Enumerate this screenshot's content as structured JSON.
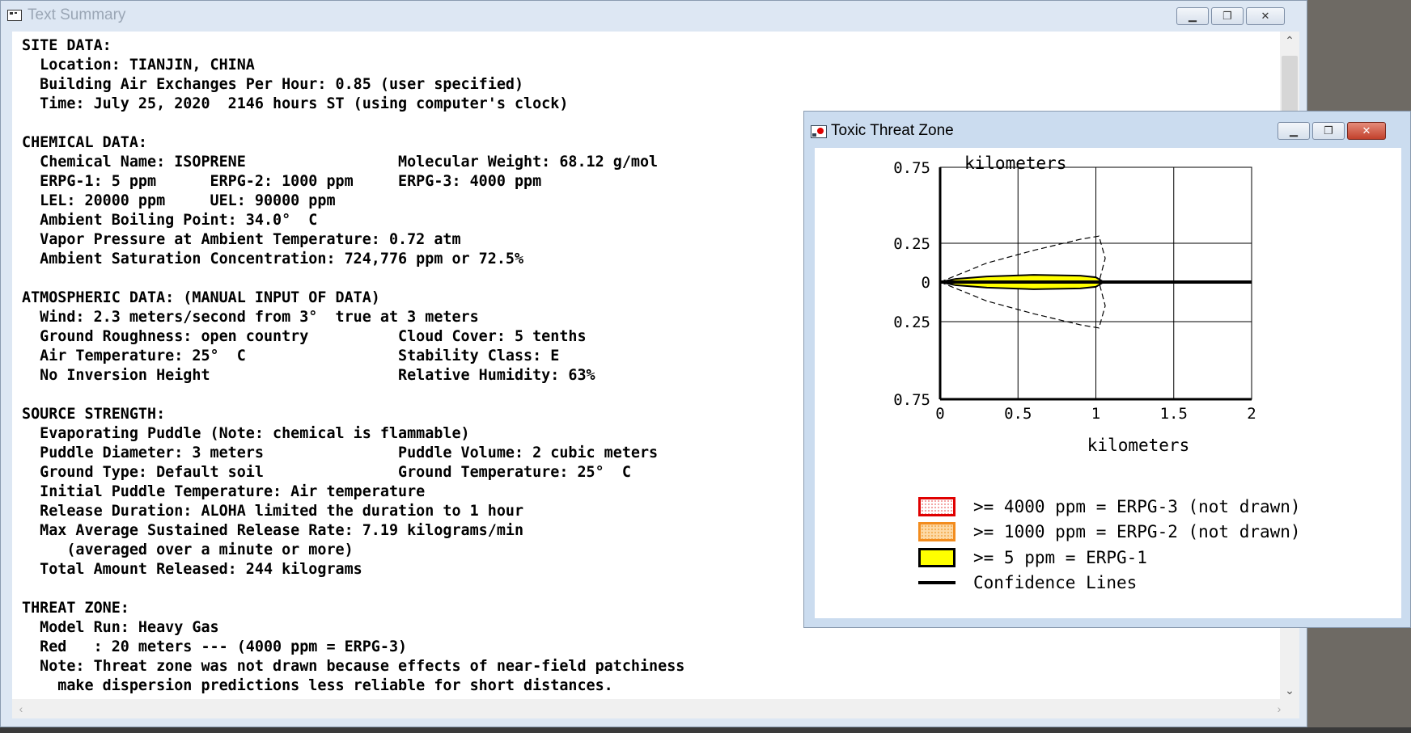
{
  "text_summary": {
    "title": "Text Summary",
    "lines": [
      "SITE DATA:",
      "  Location: TIANJIN, CHINA",
      "  Building Air Exchanges Per Hour: 0.85 (user specified)",
      "  Time: July 25, 2020  2146 hours ST (using computer's clock)",
      "",
      "CHEMICAL DATA:",
      "  Chemical Name: ISOPRENE                 Molecular Weight: 68.12 g/mol",
      "  ERPG-1: 5 ppm      ERPG-2: 1000 ppm     ERPG-3: 4000 ppm",
      "  LEL: 20000 ppm     UEL: 90000 ppm",
      "  Ambient Boiling Point: 34.0°  C",
      "  Vapor Pressure at Ambient Temperature: 0.72 atm",
      "  Ambient Saturation Concentration: 724,776 ppm or 72.5%",
      "",
      "ATMOSPHERIC DATA: (MANUAL INPUT OF DATA)",
      "  Wind: 2.3 meters/second from 3°  true at 3 meters",
      "  Ground Roughness: open country          Cloud Cover: 5 tenths",
      "  Air Temperature: 25°  C                 Stability Class: E",
      "  No Inversion Height                     Relative Humidity: 63%",
      "",
      "SOURCE STRENGTH:",
      "  Evaporating Puddle (Note: chemical is flammable)",
      "  Puddle Diameter: 3 meters               Puddle Volume: 2 cubic meters",
      "  Ground Type: Default soil               Ground Temperature: 25°  C",
      "  Initial Puddle Temperature: Air temperature",
      "  Release Duration: ALOHA limited the duration to 1 hour",
      "  Max Average Sustained Release Rate: 7.19 kilograms/min",
      "     (averaged over a minute or more)",
      "  Total Amount Released: 244 kilograms",
      "",
      "THREAT ZONE:",
      "  Model Run: Heavy Gas",
      "  Red   : 20 meters --- (4000 ppm = ERPG-3)",
      "  Note: Threat zone was not drawn because effects of near-field patchiness",
      "    make dispersion predictions less reliable for short distances."
    ]
  },
  "threat_zone": {
    "title": "Toxic Threat Zone",
    "y_axis_label": "kilometers",
    "x_axis_label": "kilometers",
    "y_ticks": [
      "0.75",
      "0.25",
      "0",
      "0.25",
      "0.75"
    ],
    "x_ticks": [
      "0",
      "0.5",
      "1",
      "1.5",
      "2"
    ],
    "legend": [
      {
        "label": ">= 4000 ppm = ERPG-3 (not drawn)",
        "swatch": "sw3"
      },
      {
        "label": ">= 1000 ppm = ERPG-2 (not drawn)",
        "swatch": "sw2"
      },
      {
        "label": ">= 5 ppm = ERPG-1",
        "swatch": "sw1"
      },
      {
        "label": "Confidence Lines",
        "swatch": "swline"
      }
    ],
    "colors": {
      "erpg3": "#e00000",
      "erpg2": "#f28c1e",
      "erpg1": "#ffff00",
      "confidence": "#000000"
    }
  },
  "chart_data": {
    "type": "area",
    "xlabel": "kilometers",
    "ylabel": "kilometers",
    "xlim": [
      0,
      2
    ],
    "ylim": [
      -0.75,
      0.75
    ],
    "x_ticks": [
      0,
      0.5,
      1,
      1.5,
      2
    ],
    "y_ticks_labels": [
      "0.75",
      "0.25",
      "0",
      "0.25",
      "0.75"
    ],
    "grid": true,
    "series": [
      {
        "name": ">= 5 ppm = ERPG-1",
        "x": [
          0,
          0.1,
          0.3,
          0.6,
          0.9,
          1.0,
          1.05
        ],
        "y_halfwidth": [
          0,
          0.02,
          0.035,
          0.045,
          0.04,
          0.03,
          0
        ]
      },
      {
        "name": "Confidence Lines",
        "x": [
          0,
          0.3,
          0.6,
          0.9,
          1.02,
          1.06,
          1.02
        ],
        "y_halfwidth": [
          0,
          0.12,
          0.2,
          0.27,
          0.29,
          0.15,
          0
        ]
      }
    ],
    "centerline": {
      "x": [
        0,
        2
      ],
      "y": [
        0,
        0
      ]
    }
  }
}
